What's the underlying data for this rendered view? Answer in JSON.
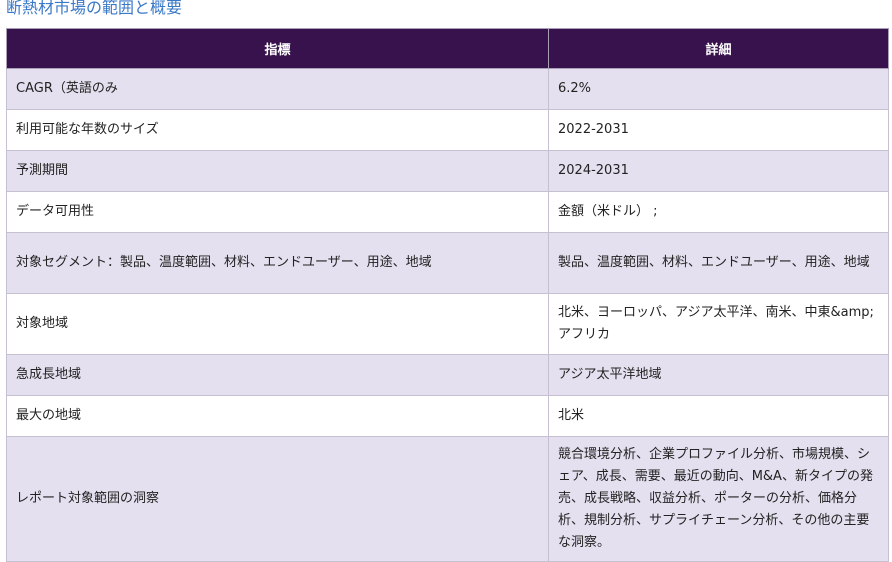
{
  "section_title": "断熱材市場の範囲と概要",
  "table": {
    "headers": [
      "指標",
      "詳細"
    ],
    "rows": [
      {
        "metric": "CAGR（英語のみ",
        "detail": "6.2%"
      },
      {
        "metric": "利用可能な年数のサイズ",
        "detail": "2022-2031"
      },
      {
        "metric": "予測期間",
        "detail": "2024-2031"
      },
      {
        "metric": "データ可用性",
        "detail": "金額（米ドル）  ;"
      },
      {
        "metric": "対象セグメント：製品、温度範囲、材料、エンドユーザー、用途、地域",
        "detail": "製品、温度範囲、材料、エンドユーザー、用途、地域"
      },
      {
        "metric": "対象地域",
        "detail": "北米、ヨーロッパ、アジア太平洋、南米、中東&amp;アフリカ"
      },
      {
        "metric": "急成長地域",
        "detail": "アジア太平洋地域"
      },
      {
        "metric": "最大の地域",
        "detail": "北米"
      },
      {
        "metric": "レポート対象範囲の洞察",
        "detail": "競合環境分析、企業プロファイル分析、市場規模、シェア、成長、需要、最近の動向、M&A、新タイプの発売、成長戦略、収益分析、ポーターの分析、価格分析、規制分析、サプライチェーン分析、その他の主要な洞察。"
      }
    ]
  }
}
